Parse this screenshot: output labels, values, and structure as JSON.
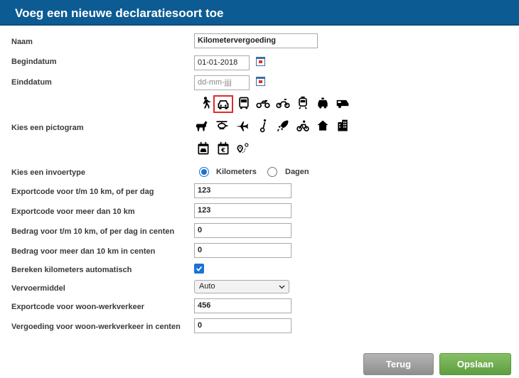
{
  "dialog": {
    "title": "Voeg een nieuwe declaratiesoort toe"
  },
  "form": {
    "naam": {
      "label": "Naam",
      "value": "Kilometervergoeding"
    },
    "begindatum": {
      "label": "Begindatum",
      "value": "01-01-2018"
    },
    "einddatum": {
      "label": "Einddatum",
      "placeholder": "dd-mm-jjjj"
    },
    "pictogram": {
      "label": "Kies een pictogram",
      "selected": "car-icon",
      "icons": [
        "walking-person-icon",
        "car-icon",
        "bus-icon",
        "motorcycle-icon",
        "scooter-icon",
        "train-icon",
        "taxi-icon",
        "camper-icon",
        "horse-icon",
        "helicopter-icon",
        "airplane-icon",
        "segway-icon",
        "rocket-icon",
        "bicycle-icon",
        "house-icon",
        "office-building-icon",
        "calendar-car-icon",
        "calendar-euro-icon",
        "route-pin-icon"
      ]
    },
    "invoertype": {
      "label": "Kies een invoertype",
      "options": [
        {
          "label": "Kilometers",
          "checked": true
        },
        {
          "label": "Dagen",
          "checked": false
        }
      ]
    },
    "exportcode_10km": {
      "label": "Exportcode voor t/m 10 km, of per dag",
      "value": "123"
    },
    "exportcode_meer": {
      "label": "Exportcode voor meer dan 10 km",
      "value": "123"
    },
    "bedrag_10km": {
      "label": "Bedrag voor t/m 10 km, of per dag in centen",
      "value": "0"
    },
    "bedrag_meer": {
      "label": "Bedrag voor meer dan 10 km in centen",
      "value": "0"
    },
    "automatisch": {
      "label": "Bereken kilometers automatisch",
      "checked": true
    },
    "vervoermiddel": {
      "label": "Vervoermiddel",
      "value": "Auto"
    },
    "exportcode_ww": {
      "label": "Exportcode voor woon-werkverkeer",
      "value": "456"
    },
    "vergoeding_ww": {
      "label": "Vergoeding voor woon-werkverkeer in centen",
      "value": "0"
    }
  },
  "buttons": {
    "back": "Terug",
    "save": "Opslaan"
  },
  "colors": {
    "header": "#0c5b93",
    "accent": "#1a73d4",
    "selected_border": "#e0292b",
    "save": "#6aaa4a",
    "back": "#9e9e9e"
  }
}
